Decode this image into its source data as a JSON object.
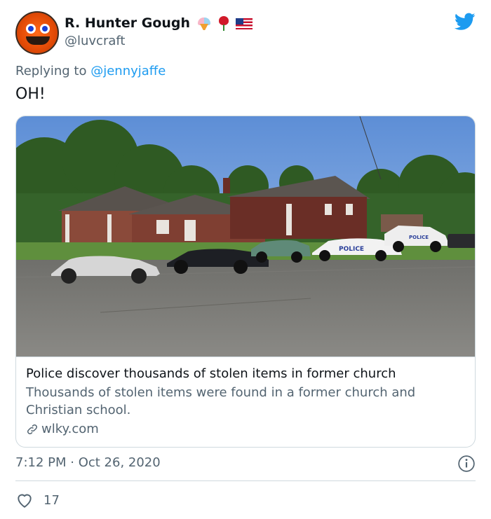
{
  "author": {
    "name": "R. Hunter Gough",
    "handle": "@luvcraft",
    "emoji_icons": [
      "ice-cream-icon",
      "rose-icon",
      "us-flag-icon"
    ]
  },
  "reply": {
    "prefix": "Replying to",
    "mention": "@jennyjaffe"
  },
  "tweet": {
    "text": "OH!"
  },
  "card": {
    "title": "Police discover thousands of stolen items in former church",
    "description": "Thousands of stolen items were found in a former church and Christian school.",
    "domain": "wlky.com",
    "image_police_text_1": "POLICE",
    "image_police_text_2": "POLICE"
  },
  "meta": {
    "timestamp": "7:12 PM · Oct 26, 2020",
    "likes": "17"
  },
  "colors": {
    "brand": "#1d9bf0",
    "secondary_text": "#536471",
    "border": "#cfd9de"
  }
}
